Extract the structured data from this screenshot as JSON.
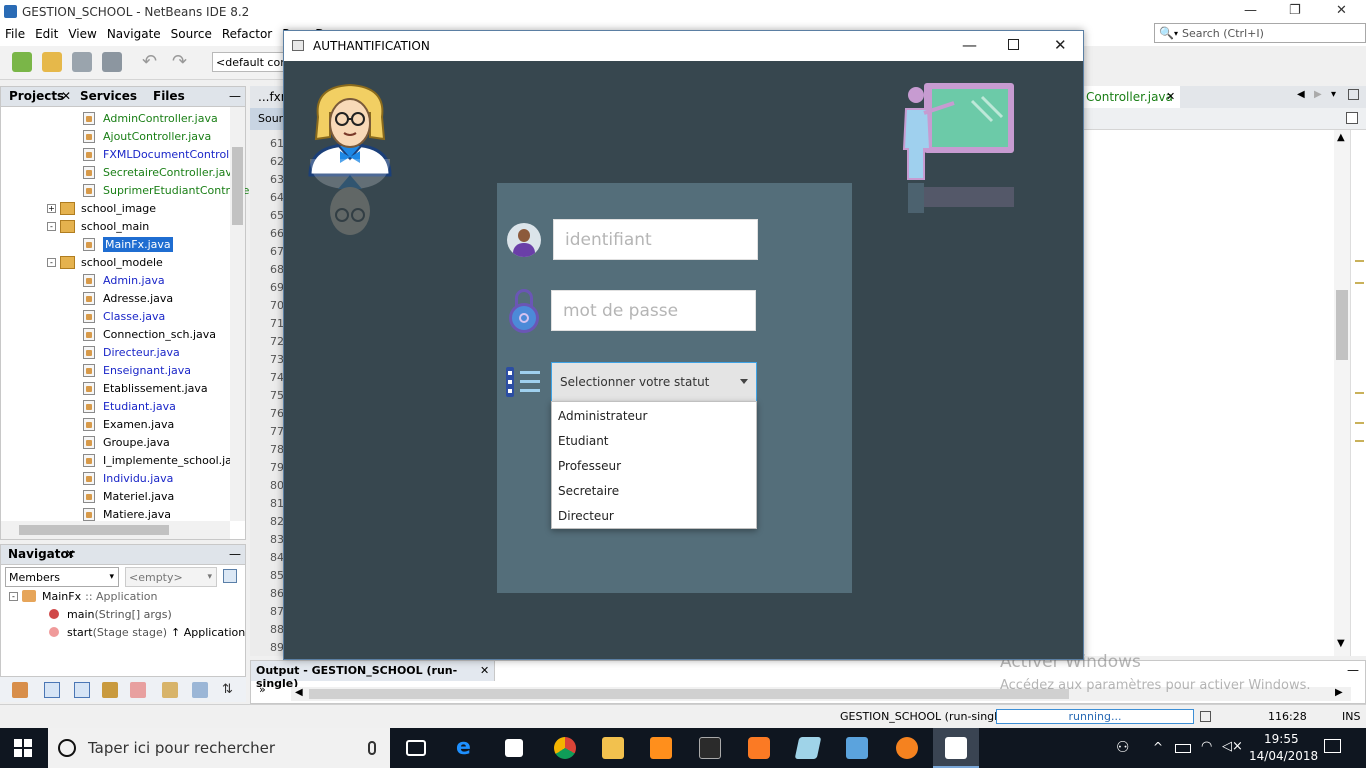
{
  "ide": {
    "title": "GESTION_SCHOOL - NetBeans IDE 8.2",
    "menu": [
      "File",
      "Edit",
      "View",
      "Navigate",
      "Source",
      "Refactor",
      "Run",
      "D"
    ],
    "search_placeholder": "Search (Ctrl+I)",
    "config_combo": "<default conf",
    "left_tabs": [
      "Projects",
      "Services",
      "Files"
    ],
    "tree": [
      {
        "label": "AdminController.java",
        "color": "green",
        "kind": "file",
        "indent": 1
      },
      {
        "label": "AjoutController.java",
        "color": "green",
        "kind": "file",
        "indent": 1
      },
      {
        "label": "FXMLDocumentController.",
        "color": "blue",
        "kind": "file",
        "indent": 1
      },
      {
        "label": "SecretaireController.java",
        "color": "green",
        "kind": "file",
        "indent": 1
      },
      {
        "label": "SuprimerEtudiantControlle",
        "color": "green",
        "kind": "file",
        "indent": 1
      },
      {
        "label": "school_image",
        "color": "black",
        "kind": "pkg",
        "indent": 0,
        "exp": "+"
      },
      {
        "label": "school_main",
        "color": "black",
        "kind": "pkg",
        "indent": 0,
        "exp": "-"
      },
      {
        "label": "MainFx.java",
        "color": "sel",
        "kind": "file",
        "indent": 1
      },
      {
        "label": "school_modele",
        "color": "black",
        "kind": "pkg",
        "indent": 0,
        "exp": "-"
      },
      {
        "label": "Admin.java",
        "color": "blue",
        "kind": "file",
        "indent": 1
      },
      {
        "label": "Adresse.java",
        "color": "black",
        "kind": "file",
        "indent": 1
      },
      {
        "label": "Classe.java",
        "color": "blue",
        "kind": "file",
        "indent": 1
      },
      {
        "label": "Connection_sch.java",
        "color": "black",
        "kind": "file",
        "indent": 1
      },
      {
        "label": "Directeur.java",
        "color": "blue",
        "kind": "file",
        "indent": 1
      },
      {
        "label": "Enseignant.java",
        "color": "blue",
        "kind": "file",
        "indent": 1
      },
      {
        "label": "Etablissement.java",
        "color": "black",
        "kind": "file",
        "indent": 1
      },
      {
        "label": "Etudiant.java",
        "color": "blue",
        "kind": "file",
        "indent": 1
      },
      {
        "label": "Examen.java",
        "color": "black",
        "kind": "file",
        "indent": 1
      },
      {
        "label": "Groupe.java",
        "color": "black",
        "kind": "file",
        "indent": 1
      },
      {
        "label": "I_implemente_school.java",
        "color": "black",
        "kind": "file",
        "indent": 1
      },
      {
        "label": "Individu.java",
        "color": "blue",
        "kind": "file",
        "indent": 1
      },
      {
        "label": "Materiel.java",
        "color": "black",
        "kind": "file",
        "indent": 1
      },
      {
        "label": "Matiere.java",
        "color": "black",
        "kind": "file",
        "indent": 1
      }
    ],
    "navigator": {
      "tab": "Navigator",
      "members_combo": "Members",
      "filter_combo": "<empty>",
      "root": "MainFx",
      "root_suffix": ":: Application",
      "items": [
        {
          "name": "main",
          "sig": "(String[] args)",
          "suffix": ""
        },
        {
          "name": "start",
          "sig": "(Stage stage)",
          "suffix": "↑ Application"
        }
      ]
    },
    "editor": {
      "tab_left": "...fxm",
      "tab_source": "Sour",
      "tab_right": "Controller.java",
      "line_numbers": [
        "61",
        "62",
        "63",
        "64",
        "65",
        "66",
        "67",
        "68",
        "69",
        "70",
        "71",
        "72",
        "73",
        "74",
        "75",
        "76",
        "77",
        "78",
        "79",
        "80",
        "81",
        "82",
        "83",
        "84",
        "85",
        "86",
        "87",
        "88",
        "89"
      ]
    },
    "output_tab": "Output - GESTION_SCHOOL (run-single)",
    "status": {
      "task": "GESTION_SCHOOL (run-single)",
      "progress_label": "running...",
      "position": "116:28",
      "mode": "INS"
    }
  },
  "dialog": {
    "title": "AUTHANTIFICATION",
    "username_placeholder": "identifiant",
    "password_placeholder": "mot de passe",
    "status_combo": "Selectionner votre statut",
    "status_options": [
      "Administrateur",
      "Etudiant",
      "Professeur",
      "Secretaire",
      "Directeur"
    ]
  },
  "watermark": {
    "line1": "Activer Windows",
    "line2": "Accédez aux paramètres pour activer Windows."
  },
  "taskbar": {
    "search_placeholder": "Taper ici pour rechercher",
    "time": "19:55",
    "date": "14/04/2018"
  },
  "colors": {
    "dialog_bg": "#37474f",
    "card_bg": "#546e7a",
    "combo_focus": "#3ea3e6",
    "selection": "#1f6dd1"
  }
}
